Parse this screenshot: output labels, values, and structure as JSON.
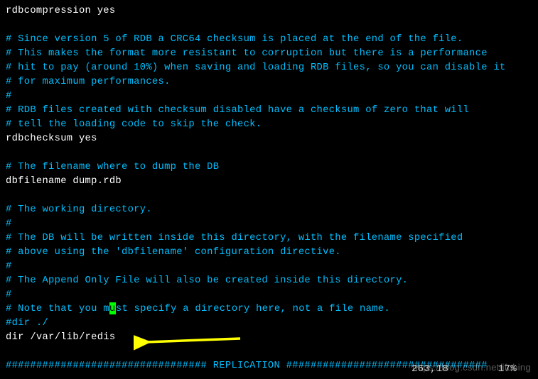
{
  "lines": [
    {
      "class": "setting",
      "text": "rdbcompression yes"
    },
    {
      "class": "setting",
      "text": ""
    },
    {
      "class": "comment",
      "text": "# Since version 5 of RDB a CRC64 checksum is placed at the end of the file."
    },
    {
      "class": "comment",
      "text": "# This makes the format more resistant to corruption but there is a performance"
    },
    {
      "class": "comment",
      "text": "# hit to pay (around 10%) when saving and loading RDB files, so you can disable it"
    },
    {
      "class": "comment",
      "text": "# for maximum performances."
    },
    {
      "class": "comment",
      "text": "#"
    },
    {
      "class": "comment",
      "text": "# RDB files created with checksum disabled have a checksum of zero that will"
    },
    {
      "class": "comment",
      "text": "# tell the loading code to skip the check."
    },
    {
      "class": "setting",
      "text": "rdbchecksum yes"
    },
    {
      "class": "setting",
      "text": ""
    },
    {
      "class": "comment",
      "text": "# The filename where to dump the DB"
    },
    {
      "class": "setting",
      "text": "dbfilename dump.rdb"
    },
    {
      "class": "setting",
      "text": ""
    },
    {
      "class": "comment",
      "text": "# The working directory."
    },
    {
      "class": "comment",
      "text": "#"
    },
    {
      "class": "comment",
      "text": "# The DB will be written inside this directory, with the filename specified"
    },
    {
      "class": "comment",
      "text": "# above using the 'dbfilename' configuration directive."
    },
    {
      "class": "comment",
      "text": "#"
    },
    {
      "class": "comment",
      "text": "# The Append Only File will also be created inside this directory."
    },
    {
      "class": "comment",
      "text": "#"
    }
  ],
  "cursor_line": {
    "before": "# Note that you m",
    "cursor_char": "u",
    "after": "st specify a directory here, not a file name."
  },
  "after_cursor_lines": [
    {
      "class": "comment",
      "text": "#dir ./"
    },
    {
      "class": "setting",
      "text": "dir /var/lib/redis"
    },
    {
      "class": "setting",
      "text": ""
    },
    {
      "class": "comment",
      "text": "################################# REPLICATION #################################"
    }
  ],
  "status": {
    "position": "263,18",
    "percent": "17%"
  },
  "watermark": "https://blog.csdn.net/ifubing",
  "colors": {
    "background": "#000000",
    "comment": "#00bfff",
    "text": "#ffffff",
    "cursor": "#00ff00",
    "arrow": "#ffff00"
  }
}
